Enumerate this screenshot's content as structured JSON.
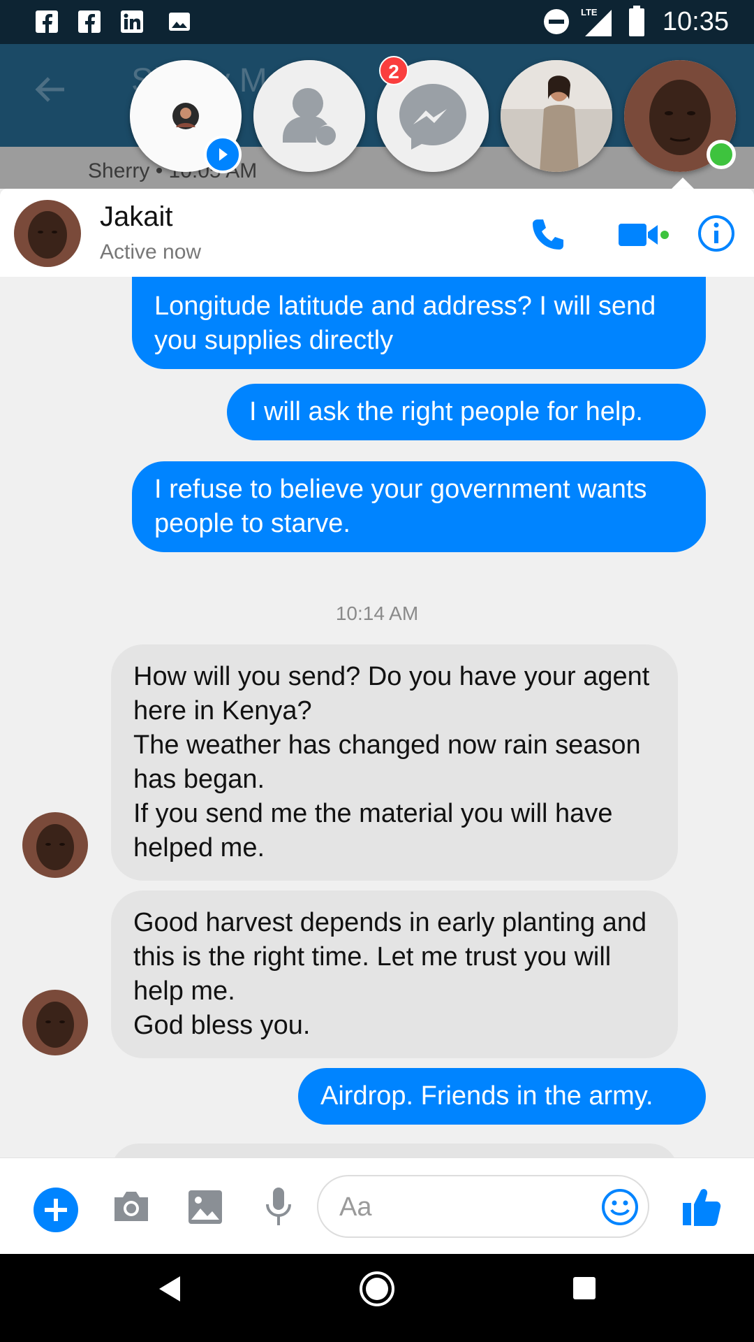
{
  "status_bar": {
    "time": "10:35",
    "network": "LTE"
  },
  "background": {
    "title": "Sherry M...",
    "subtitle": "Sherry • 10:05 AM"
  },
  "chat_heads": {
    "badge_count": "2"
  },
  "chat_header": {
    "name": "Jakait",
    "status": "Active now"
  },
  "messages": [
    {
      "side": "sent",
      "text": "Longitude latitude and address? I will send you supplies directly"
    },
    {
      "side": "sent",
      "text": "I will ask the right people for help."
    },
    {
      "side": "sent",
      "text": "I refuse to believe your government wants people to starve."
    },
    {
      "side": "recv",
      "text": "How will you send? Do you have your agent here in Kenya?\nThe weather has changed now rain season has began.\nIf you send me the material you will have helped me."
    },
    {
      "side": "recv",
      "text": "Good harvest depends in early planting and this is the right time. Let me trust you will help me.\nGod bless you."
    },
    {
      "side": "sent",
      "text": "Airdrop. Friends in the army."
    }
  ],
  "timestamp": "10:14 AM",
  "composer": {
    "placeholder": "Aa"
  },
  "colors": {
    "accent": "#0084ff",
    "online": "#3ec33e",
    "badge": "#fa3e3e"
  },
  "icons": {
    "status_left": [
      "facebook-icon",
      "facebook-icon",
      "linkedin-icon",
      "image-icon"
    ],
    "status_right": [
      "do-not-disturb-icon",
      "signal-icon",
      "battery-icon"
    ],
    "composer": [
      "plus-icon",
      "camera-icon",
      "gallery-icon",
      "mic-icon",
      "emoji-icon",
      "thumbs-up-icon"
    ],
    "header": [
      "phone-icon",
      "video-icon",
      "info-icon"
    ]
  }
}
